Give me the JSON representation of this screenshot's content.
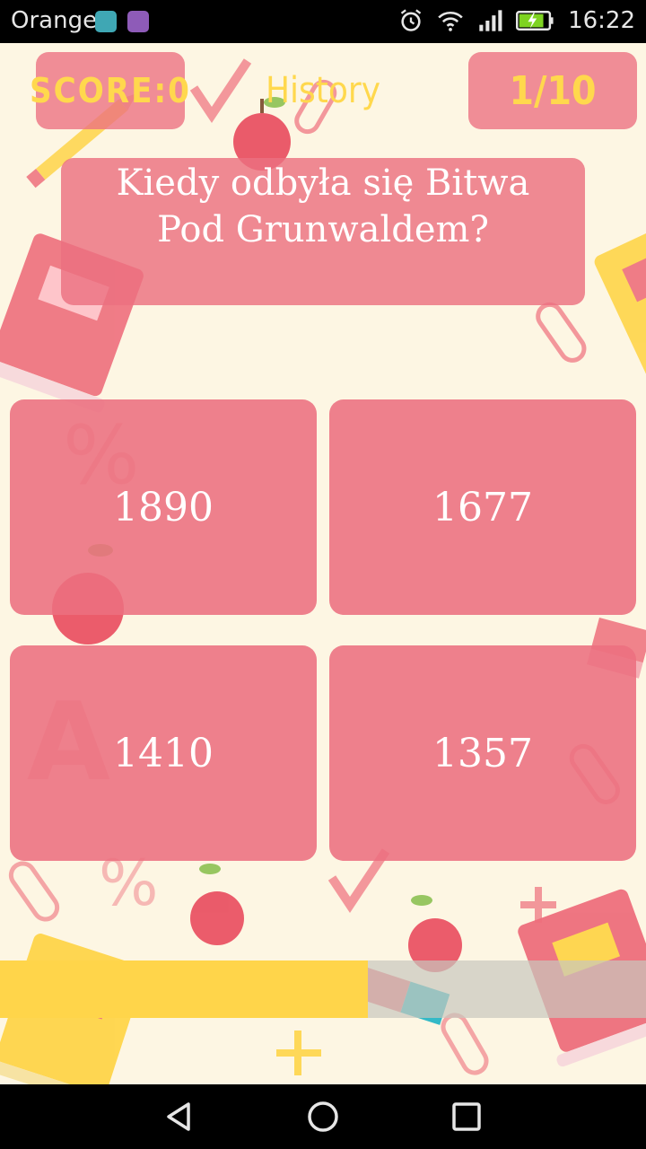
{
  "status_bar": {
    "carrier": "Orange",
    "time": "16:22"
  },
  "header": {
    "score_label": "SCORE:0",
    "category": "History",
    "counter": "1/10"
  },
  "question": {
    "text": "Kiedy odbyła się Bitwa Pod Grunwaldem?"
  },
  "answers": [
    {
      "label": "1890"
    },
    {
      "label": "1677"
    },
    {
      "label": "1410"
    },
    {
      "label": "1357"
    }
  ],
  "timer": {
    "remaining_fraction": 0.57
  },
  "colors": {
    "card": "#ec7080",
    "accent_yellow": "#ffd54a",
    "background": "#fdf6e3"
  },
  "icons": [
    "android-debug-icon",
    "gallery-icon",
    "alarm-icon",
    "wifi-icon",
    "signal-icon",
    "battery-charging-icon",
    "back-icon",
    "home-icon",
    "recents-icon"
  ]
}
